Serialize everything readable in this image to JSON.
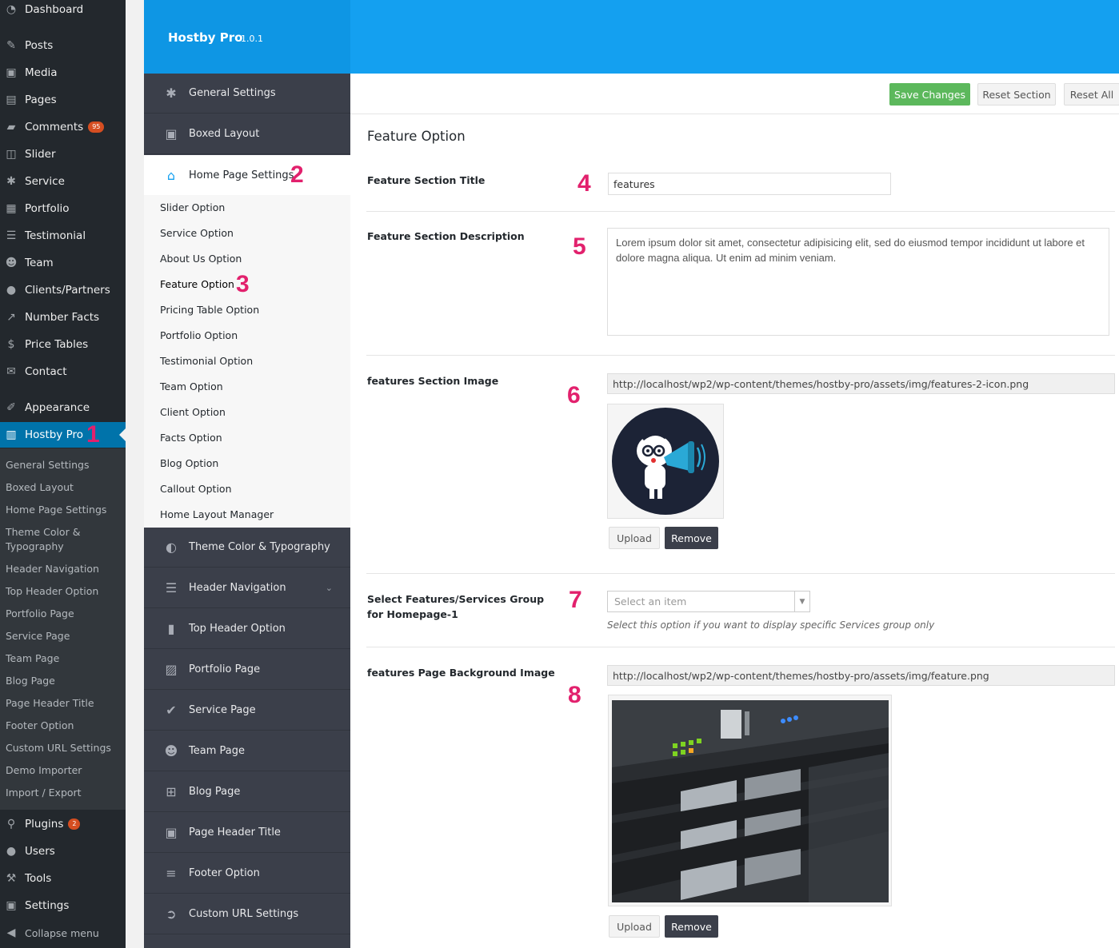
{
  "wp_menu": {
    "items": [
      {
        "label": "Dashboard",
        "icon": "dashboard-icon"
      },
      {
        "label": "Posts",
        "icon": "pin-icon"
      },
      {
        "label": "Media",
        "icon": "media-icon"
      },
      {
        "label": "Pages",
        "icon": "pages-icon"
      },
      {
        "label": "Comments",
        "icon": "comment-icon",
        "badge": "95"
      },
      {
        "label": "Slider",
        "icon": "slider-icon"
      },
      {
        "label": "Service",
        "icon": "gear-icon"
      },
      {
        "label": "Portfolio",
        "icon": "portfolio-icon"
      },
      {
        "label": "Testimonial",
        "icon": "list-icon"
      },
      {
        "label": "Team",
        "icon": "team-icon"
      },
      {
        "label": "Clients/Partners",
        "icon": "user-icon"
      },
      {
        "label": "Number Facts",
        "icon": "chart-icon"
      },
      {
        "label": "Price Tables",
        "icon": "dollar-icon"
      },
      {
        "label": "Contact",
        "icon": "mail-icon"
      },
      {
        "label": "Appearance",
        "icon": "brush-icon"
      },
      {
        "label": "Hostby Pro",
        "icon": "table-icon"
      },
      {
        "label": "Plugins",
        "icon": "plugin-icon",
        "badge": "2"
      },
      {
        "label": "Users",
        "icon": "users-icon"
      },
      {
        "label": "Tools",
        "icon": "wrench-icon"
      },
      {
        "label": "Settings",
        "icon": "settings-icon"
      },
      {
        "label": "Collapse menu",
        "icon": "collapse-icon"
      }
    ],
    "submenu": [
      "General Settings",
      "Boxed Layout",
      "Home Page Settings",
      "Theme Color & Typography",
      "Header Navigation",
      "Top Header Option",
      "Portfolio Page",
      "Service Page",
      "Team Page",
      "Blog Page",
      "Page Header Title",
      "Footer Option",
      "Custom URL Settings",
      "Demo Importer",
      "Import / Export"
    ]
  },
  "markers": [
    "1",
    "2",
    "3",
    "4",
    "5",
    "6",
    "7",
    "8"
  ],
  "panel": {
    "brand": "Hostby Pro",
    "version": "1.0.1",
    "nav": [
      {
        "label": "General Settings",
        "icon": "gear-icon"
      },
      {
        "label": "Boxed Layout",
        "icon": "window-icon"
      },
      {
        "label": "Home Page Settings",
        "icon": "home-icon"
      },
      {
        "label": "Theme Color & Typography",
        "icon": "half-circle-icon"
      },
      {
        "label": "Header Navigation",
        "icon": "menu-icon"
      },
      {
        "label": "Top Header Option",
        "icon": "document-icon"
      },
      {
        "label": "Portfolio Page",
        "icon": "image-icon"
      },
      {
        "label": "Service Page",
        "icon": "check-circle-icon"
      },
      {
        "label": "Team Page",
        "icon": "user-icon"
      },
      {
        "label": "Blog Page",
        "icon": "grid-icon"
      },
      {
        "label": "Page Header Title",
        "icon": "window-icon"
      },
      {
        "label": "Footer Option",
        "icon": "align-icon"
      },
      {
        "label": "Custom URL Settings",
        "icon": "arrow-circle-icon"
      }
    ],
    "home_sub": [
      "Slider Option",
      "Service Option",
      "About Us Option",
      "Feature Option",
      "Pricing Table Option",
      "Portfolio Option",
      "Testimonial Option",
      "Team Option",
      "Client Option",
      "Facts Option",
      "Blog Option",
      "Callout Option",
      "Home Layout Manager"
    ]
  },
  "toolbar": {
    "save": "Save Changes",
    "reset_section": "Reset Section",
    "reset_all": "Reset All"
  },
  "content": {
    "section_title": "Feature Option",
    "title_label": "Feature Section Title",
    "title_value": "features",
    "desc_label": "Feature Section Description",
    "desc_value": "Lorem ipsum dolor sit amet, consectetur adipisicing elit, sed do eiusmod tempor incididunt ut labore et dolore magna aliqua. Ut enim ad minim veniam.",
    "image_label": "features Section Image",
    "image_url": "http://localhost/wp2/wp-content/themes/hostby-pro/assets/img/features-2-icon.png",
    "upload": "Upload",
    "remove": "Remove",
    "group_label": "Select Features/Services Group for Homepage-1",
    "group_placeholder": "Select an item",
    "group_hint": "Select this option if you want to display specific Services group only",
    "bg_label": "features Page Background Image",
    "bg_url": "http://localhost/wp2/wp-content/themes/hostby-pro/assets/img/feature.png"
  },
  "colors": {
    "accent": "#14a0f0",
    "marker": "#e2216d",
    "save": "#5cb85c"
  }
}
